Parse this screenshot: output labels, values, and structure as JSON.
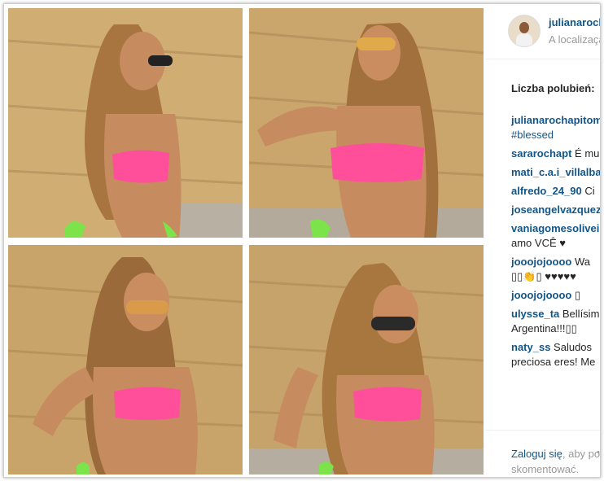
{
  "post": {
    "username": "julianarochapitombo",
    "location": "A localização",
    "likes_label": "Liczba polubień:",
    "caption": {
      "user": "julianarochapitombo",
      "text": "#blessed"
    }
  },
  "comments": [
    {
      "user": "sararochapt",
      "text": "É muito linda!",
      "line2": ""
    },
    {
      "user": "mati_c.a.i_villalba",
      "text": "",
      "line2": ""
    },
    {
      "user": "alfredo_24_90",
      "text": "Ci",
      "line2": ""
    },
    {
      "user": "joseangelvazquez",
      "text": "",
      "line2": ""
    },
    {
      "user": "vaniagomesoliveira",
      "text": "",
      "line2": "amo VCÊ ♥"
    },
    {
      "user": "jooojojoooo",
      "text": "Wa",
      "line2": "▯▯👏▯ ♥♥♥♥♥"
    },
    {
      "user": "jooojojoooo",
      "text": "▯",
      "line2": ""
    },
    {
      "user": "ulysse_ta",
      "text": "Bellísima",
      "line2": "Argentina!!!▯▯"
    },
    {
      "user": "naty_ss",
      "text": "Saludos",
      "line2": "preciosa eres! Me"
    }
  ],
  "login": {
    "link": "Zaloguj się",
    "rest": ", aby polubić lub",
    "line2": "skomentować."
  },
  "colors": {
    "link": "#125688",
    "bikini": "#ff4f9a",
    "rock": "#c9a66b"
  }
}
